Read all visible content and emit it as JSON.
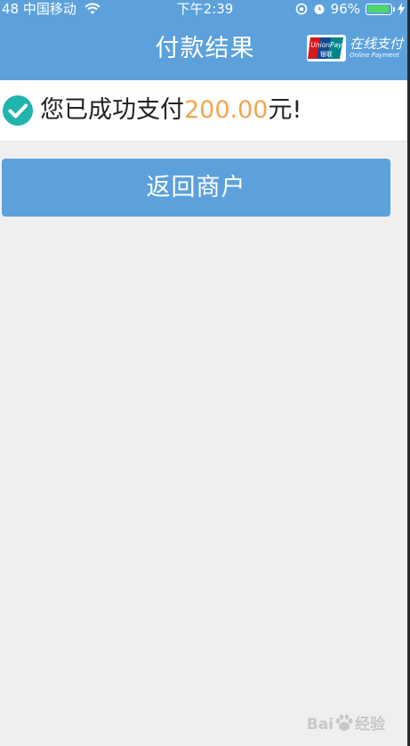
{
  "status_bar": {
    "carrier": "48 中国移动",
    "time": "下午2:39",
    "battery_percent": "96%",
    "battery_level": 0.96
  },
  "header": {
    "title": "付款结果",
    "unionpay_cn": "在线支付",
    "unionpay_en": "Online Payment",
    "logo_text_top": "UnionPay",
    "logo_text_bottom": "银联"
  },
  "result": {
    "prefix": "您已成功支付",
    "amount": "200.00",
    "suffix": "元!"
  },
  "actions": {
    "return_label": "返回商户"
  },
  "watermark": {
    "text_left": "Bai",
    "text_right": "经验"
  },
  "colors": {
    "primary": "#5ca1dc",
    "amount": "#f5a450",
    "success": "#1fb5ad"
  }
}
